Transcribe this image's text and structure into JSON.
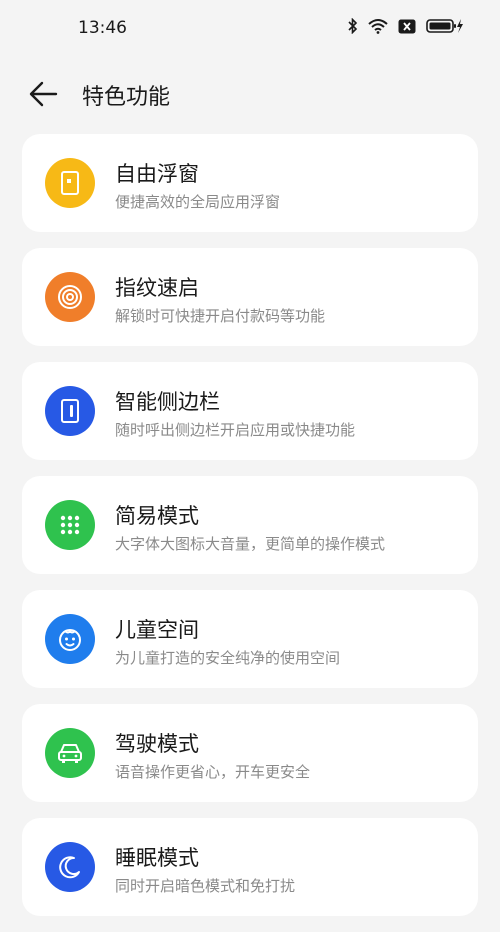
{
  "status": {
    "time": "13:46"
  },
  "header": {
    "title": "特色功能"
  },
  "items": [
    {
      "title": "自由浮窗",
      "subtitle": "便捷高效的全局应用浮窗",
      "icon": "floating-window-icon",
      "color": "#f7b916"
    },
    {
      "title": "指纹速启",
      "subtitle": "解锁时可快捷开启付款码等功能",
      "icon": "fingerprint-icon",
      "color": "#f07e2a"
    },
    {
      "title": "智能侧边栏",
      "subtitle": "随时呼出侧边栏开启应用或快捷功能",
      "icon": "sidebar-icon",
      "color": "#2759e5"
    },
    {
      "title": "简易模式",
      "subtitle": "大字体大图标大音量，更简单的操作模式",
      "icon": "grid-dots-icon",
      "color": "#2fc24e"
    },
    {
      "title": "儿童空间",
      "subtitle": "为儿童打造的安全纯净的使用空间",
      "icon": "child-face-icon",
      "color": "#1f7ded"
    },
    {
      "title": "驾驶模式",
      "subtitle": "语音操作更省心，开车更安全",
      "icon": "car-icon",
      "color": "#2fc24e"
    },
    {
      "title": "睡眠模式",
      "subtitle": "同时开启暗色模式和免打扰",
      "icon": "moon-icon",
      "color": "#2759e5"
    }
  ]
}
